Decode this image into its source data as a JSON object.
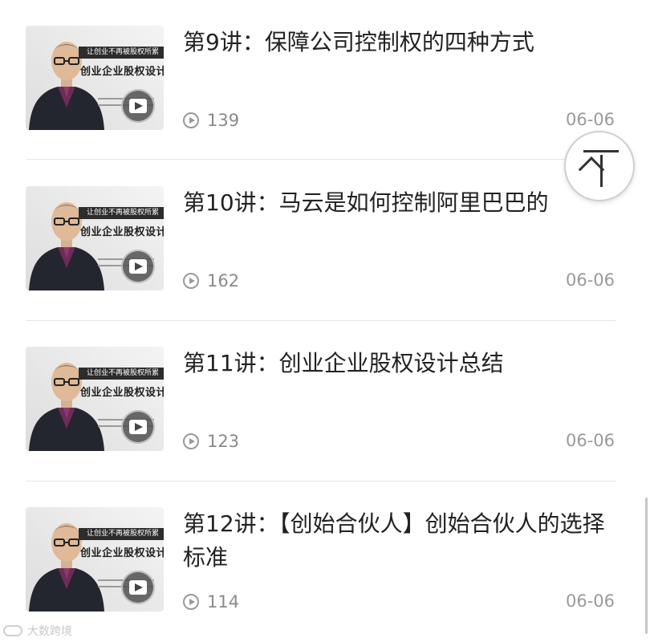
{
  "thumbnail": {
    "banner": "让创业不再被股权所累",
    "course_title": "创业企业股权设计"
  },
  "lessons": [
    {
      "title": "第9讲：保障公司控制权的四种方式",
      "views": "139",
      "date": "06-06"
    },
    {
      "title": "第10讲：马云是如何控制阿里巴巴的",
      "views": "162",
      "date": "06-06"
    },
    {
      "title": "第11讲：创业企业股权设计总结",
      "views": "123",
      "date": "06-06"
    },
    {
      "title": "第12讲：【创始合伙人】创始合伙人的选择标准",
      "views": "114",
      "date": "06-06"
    }
  ],
  "watermark": "大数跨境",
  "icons": {
    "play_overlay": "video-play-icon",
    "views": "play-count-icon",
    "back_to_top": "arrow-up-to-top-icon"
  }
}
